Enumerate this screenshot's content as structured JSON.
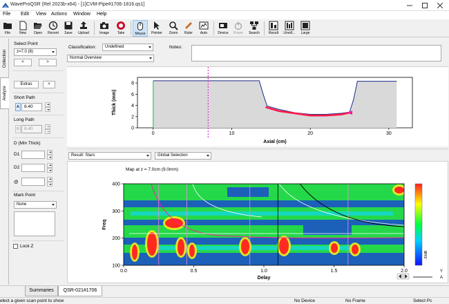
{
  "window": {
    "title": "WaveProQSR (Rel 2023b-x64) - [1]CVM-Pipe#1706-1816.qs1]"
  },
  "menu": [
    "File",
    "Edit",
    "View",
    "Actions",
    "Window",
    "Help"
  ],
  "toolbar": {
    "buttons": [
      {
        "label": "File",
        "icon": "folder-icon"
      },
      {
        "label": "New",
        "icon": "new-file-icon"
      },
      {
        "label": "Open",
        "icon": "open-folder-icon"
      },
      {
        "label": "Recent",
        "icon": "recent-icon"
      },
      {
        "label": "Save",
        "icon": "save-icon"
      },
      {
        "label": "Upload",
        "icon": "upload-icon"
      },
      {
        "label": "Image",
        "icon": "camera-icon"
      },
      {
        "label": "Take",
        "icon": "record-icon"
      },
      {
        "label": "Mouse",
        "icon": "mouse-icon"
      },
      {
        "label": "Pointer",
        "icon": "pointer-icon"
      },
      {
        "label": "Zoom",
        "icon": "zoom-icon"
      },
      {
        "label": "Ruler",
        "icon": "ruler-icon"
      },
      {
        "label": "Auto",
        "icon": "auto-icon"
      },
      {
        "label": "Device",
        "icon": "device-icon"
      },
      {
        "label": "Power",
        "icon": "power-icon"
      },
      {
        "label": "Search",
        "icon": "network-search-icon"
      },
      {
        "label": "Result",
        "icon": "result-icon"
      },
      {
        "label": "Unroll...",
        "icon": "unroll-icon"
      },
      {
        "label": "Large",
        "icon": "large-view-icon"
      }
    ]
  },
  "vtabs": {
    "collection": "Collection",
    "analyze": "Analyze"
  },
  "left": {
    "select_point_label": "Select Point",
    "select_point_value": "z=7.0 (8)",
    "prev": "<",
    "next": ">",
    "extras": "Extras",
    "extras_more": ">",
    "short_path_label": "Short Path",
    "short_path_tag": "A",
    "short_path_value": "8.40",
    "long_path_label": "Long Path",
    "long_path_tag": "B",
    "long_path_value": "8.40",
    "dmin_label": "D (Min Thick)",
    "d1": "D1",
    "d2": "D2",
    "at": "@",
    "mark_point_label": "Mark Point",
    "mark_point_value": "None",
    "lockz": "Lock Z"
  },
  "main": {
    "classification_label": "Classification:",
    "classification_value": "Undefined",
    "notes_label": "Notes:",
    "overview_value": "Normal Overview",
    "result_value": "Result: Stars",
    "selection_value": "Global Selection",
    "map_title": "Map at z = 7.0cm (9.0mm)",
    "colorbar_label": "-30dB",
    "side_y": "Y",
    "side_a": "A"
  },
  "chart_data": [
    {
      "type": "area",
      "xlabel": "Axial (cm)",
      "ylabel": "Thick (mm)",
      "xlim": [
        -2,
        33
      ],
      "ylim": [
        0,
        9
      ],
      "xticks": [
        0,
        10,
        20,
        30
      ],
      "yticks": [
        0,
        2,
        4,
        6,
        8
      ],
      "marker_x": 7,
      "series": [
        {
          "x": [
            0,
            3,
            6,
            9,
            12,
            13.5,
            14,
            14.5,
            16,
            18,
            20,
            22,
            24,
            25,
            25.5,
            26,
            28,
            31
          ],
          "values": [
            8.4,
            8.4,
            8.4,
            8.4,
            8.4,
            8.4,
            6.0,
            3.9,
            3.3,
            2.7,
            2.4,
            2.4,
            2.6,
            2.8,
            5.0,
            8.3,
            8.3,
            8.3
          ]
        },
        {
          "x": [
            14.3,
            16,
            18,
            20,
            22,
            24,
            25
          ],
          "values": [
            3.7,
            3.0,
            2.6,
            2.2,
            2.2,
            2.4,
            2.7
          ]
        }
      ]
    },
    {
      "type": "heatmap",
      "title": "Map at z = 7.0cm (9.0mm)",
      "xlabel": "Delay",
      "ylabel": "Freq",
      "xlim": [
        0.0,
        2.0
      ],
      "ylim": [
        100,
        400
      ],
      "xticks": [
        0.0,
        0.5,
        1.0,
        1.5,
        2.0
      ],
      "yticks": [
        100,
        200,
        300,
        400
      ]
    }
  ],
  "bottom_tabs": [
    "Summaries",
    "QSR-021#1706"
  ],
  "status": {
    "hint": "elect a given scan point to show",
    "device": "No Device",
    "frame": "No Frame",
    "select": "Select Pc"
  }
}
